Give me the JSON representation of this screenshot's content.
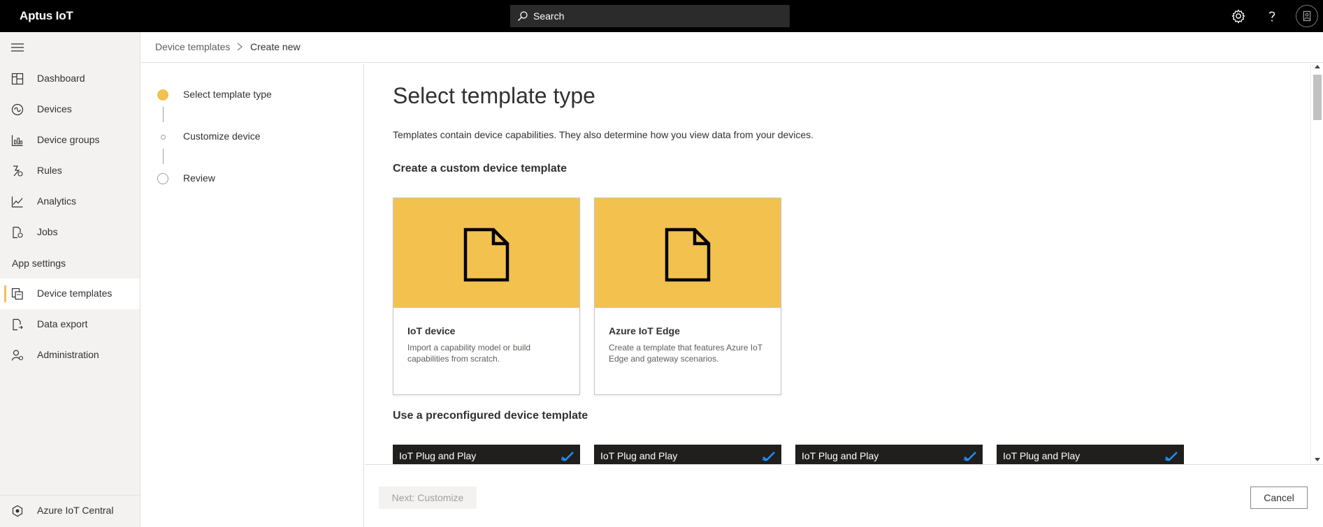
{
  "app": {
    "title": "Aptus IoT"
  },
  "search": {
    "label": "Search"
  },
  "topbar_icons": [
    "search-icon",
    "gear-icon",
    "help-icon",
    "avatar"
  ],
  "nav": {
    "items": [
      {
        "label": "Dashboard",
        "icon": "dashboard-icon"
      },
      {
        "label": "Devices",
        "icon": "devices-icon"
      },
      {
        "label": "Device groups",
        "icon": "device-groups-icon"
      },
      {
        "label": "Rules",
        "icon": "rules-icon"
      },
      {
        "label": "Analytics",
        "icon": "analytics-icon"
      },
      {
        "label": "Jobs",
        "icon": "jobs-icon"
      }
    ],
    "section": "App settings",
    "settings_items": [
      {
        "label": "Device templates",
        "icon": "device-templates-icon",
        "active": true
      },
      {
        "label": "Data export",
        "icon": "data-export-icon"
      },
      {
        "label": "Administration",
        "icon": "administration-icon"
      }
    ],
    "bottom": {
      "label": "Azure IoT Central",
      "icon": "azure-iot-central-icon"
    }
  },
  "breadcrumb": {
    "root": "Device templates",
    "current": "Create new"
  },
  "wizard": {
    "steps": [
      {
        "label": "Select template type",
        "state": "active"
      },
      {
        "label": "Customize device",
        "state": "pending"
      },
      {
        "label": "Review",
        "state": "pending"
      }
    ]
  },
  "main": {
    "title": "Select template type",
    "description": "Templates contain device capabilities. They also determine how you view data from your devices.",
    "custom_section": "Create a custom device template",
    "custom_cards": [
      {
        "title": "IoT device",
        "description": "Import a capability model or build capabilities from scratch."
      },
      {
        "title": "Azure IoT Edge",
        "description": "Create a template that features Azure IoT Edge and gateway scenarios."
      }
    ],
    "preconfigured_section": "Use a preconfigured device template",
    "preconfigured_cards": [
      {
        "label": "IoT Plug and Play"
      },
      {
        "label": "IoT Plug and Play"
      },
      {
        "label": "IoT Plug and Play"
      },
      {
        "label": "IoT Plug and Play"
      }
    ]
  },
  "footer": {
    "next_label": "Next: Customize",
    "cancel_label": "Cancel"
  },
  "colors": {
    "accent": "#f2c14e",
    "topbar": "#000000",
    "nav_bg": "#f3f2f1",
    "check": "#1e90ff"
  }
}
